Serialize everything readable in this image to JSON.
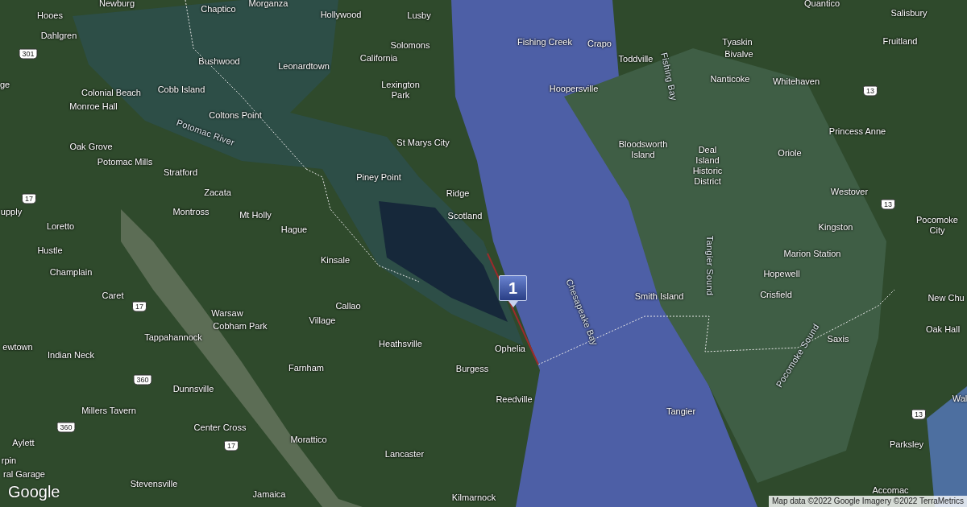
{
  "map": {
    "labels": [
      {
        "text": "Newburg",
        "kind": "place"
      },
      {
        "text": "Hooes",
        "kind": "place"
      },
      {
        "text": "Dahlgren",
        "kind": "place"
      },
      {
        "text": "Chaptico",
        "kind": "place"
      },
      {
        "text": "Morganza",
        "kind": "place"
      },
      {
        "text": "Hollywood",
        "kind": "place"
      },
      {
        "text": "Lusby",
        "kind": "place"
      },
      {
        "text": "Solomons",
        "kind": "place"
      },
      {
        "text": "California",
        "kind": "place"
      },
      {
        "text": "Bushwood",
        "kind": "place"
      },
      {
        "text": "Leonardtown",
        "kind": "place"
      },
      {
        "text": "Colonial Beach",
        "kind": "place"
      },
      {
        "text": "Cobb Island",
        "kind": "place"
      },
      {
        "text": "Lexington Park",
        "kind": "place"
      },
      {
        "text": "Monroe Hall",
        "kind": "place"
      },
      {
        "text": "Coltons Point",
        "kind": "place"
      },
      {
        "text": "Potomac River",
        "kind": "water"
      },
      {
        "text": "Oak Grove",
        "kind": "place"
      },
      {
        "text": "Potomac Mills",
        "kind": "place"
      },
      {
        "text": "Stratford",
        "kind": "place"
      },
      {
        "text": "Zacata",
        "kind": "place"
      },
      {
        "text": "Montross",
        "kind": "place"
      },
      {
        "text": "Mt Holly",
        "kind": "place"
      },
      {
        "text": "Hague",
        "kind": "place"
      },
      {
        "text": "St Marys City",
        "kind": "place"
      },
      {
        "text": "Piney Point",
        "kind": "place"
      },
      {
        "text": "Ridge",
        "kind": "place"
      },
      {
        "text": "Scotland",
        "kind": "place"
      },
      {
        "text": "ge",
        "kind": "place"
      },
      {
        "text": "upply",
        "kind": "place"
      },
      {
        "text": "Loretto",
        "kind": "place"
      },
      {
        "text": "Hustle",
        "kind": "place"
      },
      {
        "text": "Champlain",
        "kind": "place"
      },
      {
        "text": "Caret",
        "kind": "place"
      },
      {
        "text": "Kinsale",
        "kind": "place"
      },
      {
        "text": "Warsaw",
        "kind": "place"
      },
      {
        "text": "Cobham Park",
        "kind": "place"
      },
      {
        "text": "Village",
        "kind": "place"
      },
      {
        "text": "Callao",
        "kind": "place"
      },
      {
        "text": "Tappahannock",
        "kind": "place"
      },
      {
        "text": "ewtown",
        "kind": "place"
      },
      {
        "text": "Indian Neck",
        "kind": "place"
      },
      {
        "text": "Heathsville",
        "kind": "place"
      },
      {
        "text": "Farnham",
        "kind": "place"
      },
      {
        "text": "Ophelia",
        "kind": "place"
      },
      {
        "text": "Burgess",
        "kind": "place"
      },
      {
        "text": "Reedville",
        "kind": "place"
      },
      {
        "text": "Dunnsville",
        "kind": "place"
      },
      {
        "text": "Millers Tavern",
        "kind": "place"
      },
      {
        "text": "Center Cross",
        "kind": "place"
      },
      {
        "text": "Morattico",
        "kind": "place"
      },
      {
        "text": "Aylett",
        "kind": "place"
      },
      {
        "text": "rpin",
        "kind": "place"
      },
      {
        "text": "ral Garage",
        "kind": "place"
      },
      {
        "text": "Stevensville",
        "kind": "place"
      },
      {
        "text": "Lancaster",
        "kind": "place"
      },
      {
        "text": "Jamaica",
        "kind": "place"
      },
      {
        "text": "Kilmarnock",
        "kind": "place"
      },
      {
        "text": "Fishing Creek",
        "kind": "place"
      },
      {
        "text": "Crapo",
        "kind": "place"
      },
      {
        "text": "Toddville",
        "kind": "place"
      },
      {
        "text": "Fishing Bay",
        "kind": "water"
      },
      {
        "text": "Hoopersville",
        "kind": "place"
      },
      {
        "text": "Tyaskin",
        "kind": "place"
      },
      {
        "text": "Bivalve",
        "kind": "place"
      },
      {
        "text": "Nanticoke",
        "kind": "place"
      },
      {
        "text": "Whitehaven",
        "kind": "place"
      },
      {
        "text": "Quantico",
        "kind": "place"
      },
      {
        "text": "Salisbury",
        "kind": "place"
      },
      {
        "text": "Fruitland",
        "kind": "place"
      },
      {
        "text": "Princess Anne",
        "kind": "place"
      },
      {
        "text": "Bloodsworth Island",
        "kind": "place"
      },
      {
        "text": "Deal Island Historic District",
        "kind": "place"
      },
      {
        "text": "Oriole",
        "kind": "place"
      },
      {
        "text": "Westover",
        "kind": "place"
      },
      {
        "text": "Kingston",
        "kind": "place"
      },
      {
        "text": "Pocomoke City",
        "kind": "place"
      },
      {
        "text": "Marion Station",
        "kind": "place"
      },
      {
        "text": "Hopewell",
        "kind": "place"
      },
      {
        "text": "Smith Island",
        "kind": "place"
      },
      {
        "text": "Crisfield",
        "kind": "place"
      },
      {
        "text": "Tangier Sound",
        "kind": "water"
      },
      {
        "text": "Chesapeake Bay",
        "kind": "water"
      },
      {
        "text": "New Chu",
        "kind": "place"
      },
      {
        "text": "Oak Hall",
        "kind": "place"
      },
      {
        "text": "Saxis",
        "kind": "place"
      },
      {
        "text": "Pocomoke Sound",
        "kind": "water"
      },
      {
        "text": "Tangier",
        "kind": "place"
      },
      {
        "text": "Wal",
        "kind": "place"
      },
      {
        "text": "Parksley",
        "kind": "place"
      },
      {
        "text": "Accomac",
        "kind": "place"
      }
    ],
    "route_shields": [
      "301",
      "17",
      "17",
      "360",
      "360",
      "17",
      "13",
      "13",
      "13"
    ],
    "marker": {
      "label": "1"
    },
    "logo": "Google",
    "attribution": "Map data ©2022 Google Imagery ©2022 TerraMetrics"
  }
}
